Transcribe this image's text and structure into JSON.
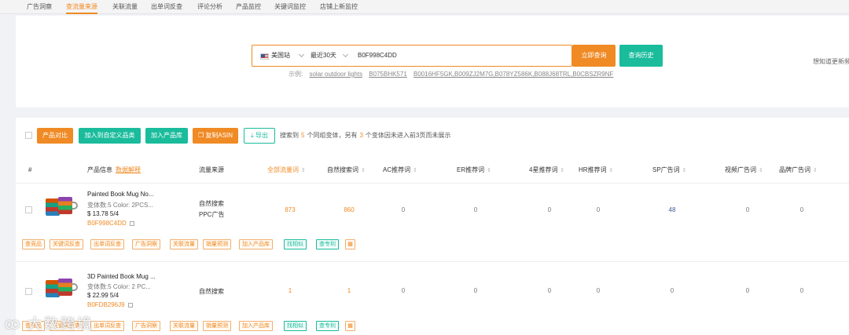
{
  "topnav": {
    "tabs": [
      "广告洞察",
      "查流量来源",
      "关联流量",
      "出单词反查",
      "评论分析",
      "产品监控",
      "关键词监控",
      "店铺上新监控"
    ]
  },
  "search": {
    "site": "美国站",
    "period": "最近30天",
    "asin": "B0F998C4DD",
    "query_button": "立即查询",
    "history_button": "查询历史",
    "examples_label": "示例:",
    "examples": [
      "solar outdoor lights",
      "B075BHK571",
      "B0016HF5GK,B009ZJ2M7G,B078YZ586K,B088J68TRL,B0CBSZR9NF"
    ],
    "update_link": "想知道更新频"
  },
  "toolbar": {
    "compare": "产品对比",
    "add_category": "加入到自定义品类",
    "add_library": "加入产品库",
    "copy_asin": "复制ASIN",
    "export": "导出",
    "summary_prefix": "搜索到",
    "variant_count": "5",
    "summary_mid": "个同组变体，另有",
    "extra_count": "3",
    "summary_suffix": "个变体因未进入前3页而未展示"
  },
  "table": {
    "headers": {
      "index": "#",
      "product": "产品信息",
      "product_hint": "数据解释",
      "source": "流量来源",
      "all": "全部流量词",
      "natural": "自然搜索词",
      "ac": "AC推荐词",
      "er": "ER推荐词",
      "star4": "4星推荐词",
      "hr": "HR推荐词",
      "sp": "SP广告词",
      "video": "视频广告词",
      "brand": "品牌广告词"
    },
    "rows": [
      {
        "name": "Painted Book Mug No...",
        "meta": "变体数:5   Color: 2PCS...",
        "price": "$ 13.78   5/4",
        "asin": "B0F998C4DD",
        "sources": [
          "自然搜索",
          "PPC广告"
        ],
        "all": "873",
        "natural": "860",
        "ac": "0",
        "er": "0",
        "star4": "0",
        "hr": "0",
        "sp": "48",
        "video": "0",
        "brand": "0"
      },
      {
        "name": "3D Painted Book Mug ...",
        "meta": "变体数:5   Color: 2 PC...",
        "price": "$ 22.99   5/4",
        "asin": "B0FDB296J9",
        "sources": [
          "自然搜索"
        ],
        "all": "1",
        "natural": "1",
        "ac": "0",
        "er": "0",
        "star4": "0",
        "hr": "0",
        "sp": "0",
        "video": "0",
        "brand": "0"
      }
    ],
    "actions": [
      "查竞品",
      "关键词反查",
      "出单词反查",
      "广告洞察",
      "关联流量",
      "销量预测",
      "加入产品库",
      "找相似",
      "查专利"
    ]
  },
  "watermark": "大数跨境"
}
